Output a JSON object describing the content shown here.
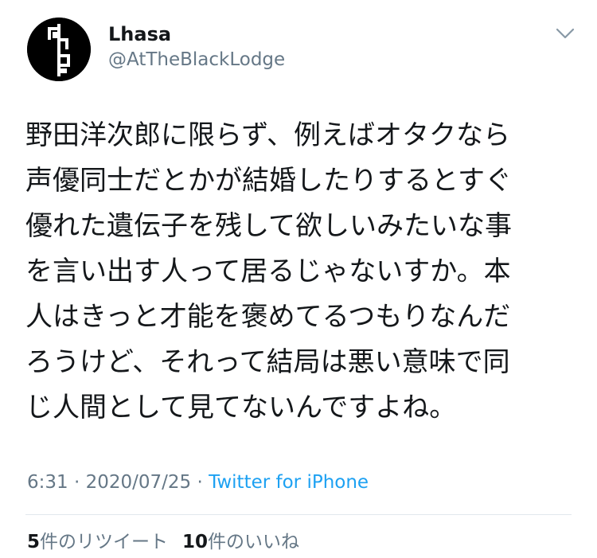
{
  "user": {
    "display_name": "Lhasa",
    "handle": "@AtTheBlackLodge",
    "avatar_icon": "bauhaus-face-logo"
  },
  "menu": {
    "icon": "chevron-down-icon"
  },
  "tweet": {
    "lines": [
      "野田洋次郎に限らず、例えばオタクなら",
      "声優同士だとかが結婚したりするとすぐ",
      "優れた遺伝子を残して欲しいみたいな事",
      "を言い出す人って居るじゃないすか。本",
      "人はきっと才能を褒めてるつもりなんだ",
      "ろうけど、それって結局は悪い意味で同",
      "じ人間として見てないんですよね。"
    ]
  },
  "meta": {
    "time": "6:31",
    "separator1": " · ",
    "date": "2020/07/25",
    "separator2": " · ",
    "source": "Twitter for iPhone"
  },
  "stats": {
    "retweets_count": "5",
    "retweets_label": "件のリツイート",
    "likes_count": "10",
    "likes_label": "件のいいね"
  },
  "colors": {
    "text": "#14171a",
    "secondary": "#657786",
    "link": "#1da1f2",
    "divider": "#e1e8ed"
  }
}
